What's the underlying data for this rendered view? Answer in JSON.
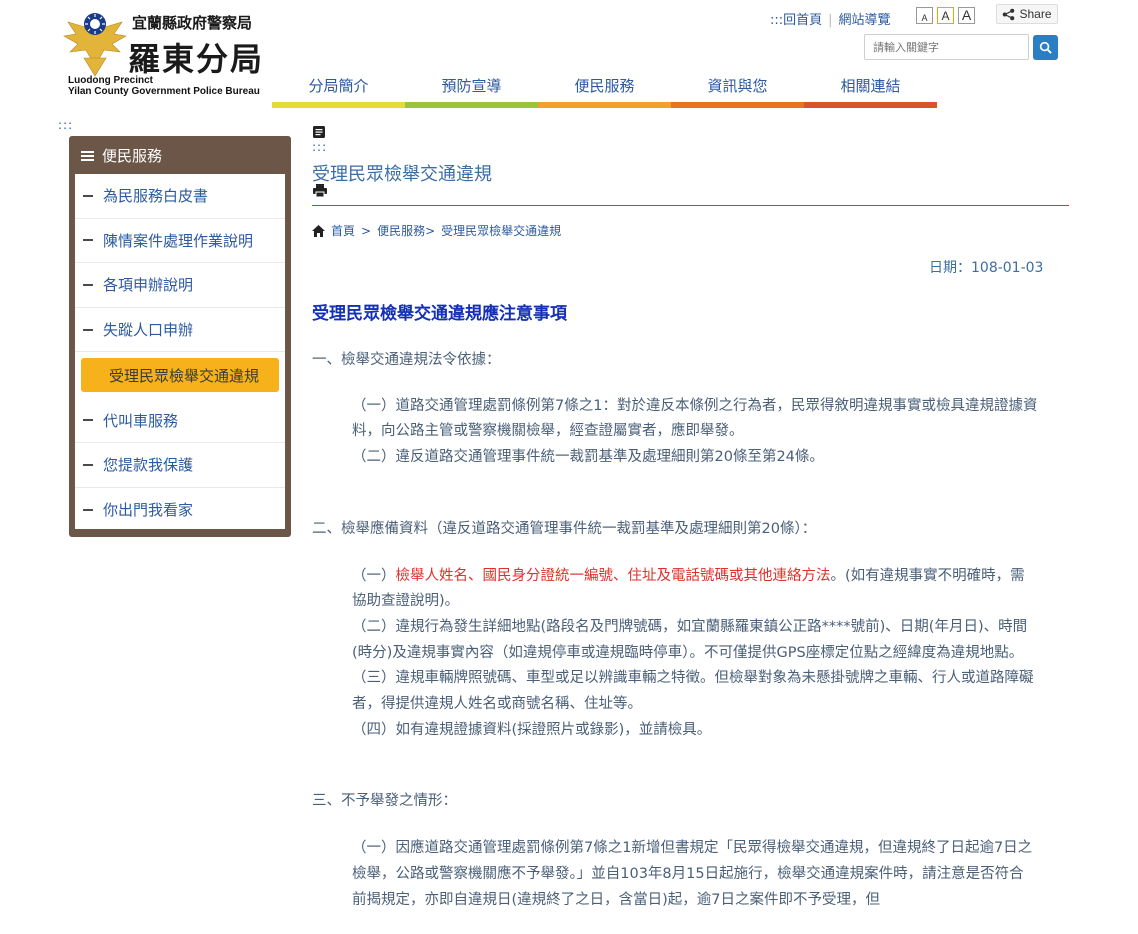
{
  "header": {
    "agency_line": "宜蘭縣政府警察局",
    "bureau_name": "羅東分局",
    "english_line1": "Luodong Precinct",
    "english_line2": "Yilan County Government Police Bureau"
  },
  "toplinks": {
    "home": ":::回首頁",
    "sitemap": "網站導覽"
  },
  "font_size_buttons": [
    "A",
    "A",
    "A"
  ],
  "share": {
    "label": "Share"
  },
  "search": {
    "placeholder": "請輸入關鍵字"
  },
  "main_nav": [
    {
      "label": "分局簡介",
      "color": "#e6d93a"
    },
    {
      "label": "預防宣導",
      "color": "#9bc43a"
    },
    {
      "label": "便民服務",
      "color": "#f2a02c"
    },
    {
      "label": "資訊與您",
      "color": "#e8731f"
    },
    {
      "label": "相關連結",
      "color": "#d9532b"
    }
  ],
  "accesskey_left": ":::",
  "accesskey_main": ":::",
  "sidebar": {
    "title": "便民服務",
    "items": [
      {
        "label": "為民服務白皮書",
        "active": false
      },
      {
        "label": "陳情案件處理作業說明",
        "active": false
      },
      {
        "label": "各項申辦說明",
        "active": false
      },
      {
        "label": "失蹤人口申辦",
        "active": false
      },
      {
        "label": "受理民眾檢舉交通違規",
        "active": true
      },
      {
        "label": "代叫車服務",
        "active": false
      },
      {
        "label": "您提款我保護",
        "active": false
      },
      {
        "label": "你出門我看家",
        "active": false
      }
    ]
  },
  "page": {
    "title": "受理民眾檢舉交通違規",
    "breadcrumb": [
      "首頁",
      ">",
      "便民服務>",
      "受理民眾檢舉交通違規"
    ],
    "date": "日期：108-01-03"
  },
  "article": {
    "heading": "受理民眾檢舉交通違規應注意事項",
    "s1_title": "一、檢舉交通違規法令依據：",
    "s1_p1": "（一）道路交通管理處罰條例第7條之1：對於違反本條例之行為者，民眾得敘明違規事實或檢具違規證據資料，向公路主管或警察機關檢舉，經查證屬實者，應即舉發。",
    "s1_p2": "（二）違反道路交通管理事件統一裁罰基準及處理細則第20條至第24條。",
    "s2_title": "二、檢舉應備資料（違反道路交通管理事件統一裁罰基準及處理細則第20條）：",
    "s2_p1_prefix": "（一）",
    "s2_p1_red": "檢舉人姓名、國民身分證統一編號、住址及電話號碼或其他連絡方法",
    "s2_p1_suffix": "。(如有違規事實不明確時，需協助查證說明)。",
    "s2_p2": "（二）違規行為發生詳細地點(路段名及門牌號碼，如宜蘭縣羅東鎮公正路****號前)、日期(年月日)、時間(時分)及違規事實內容（如違規停車或違規臨時停車）。不可僅提供GPS座標定位點之經緯度為違規地點。",
    "s2_p3": "（三）違規車輛牌照號碼、車型或足以辨識車輛之特徵。但檢舉對象為未懸掛號牌之車輛、行人或道路障礙者，得提供違規人姓名或商號名稱、住址等。",
    "s2_p4": "（四）如有違規證據資料(採證照片或錄影)，並請檢具。",
    "s3_title": "三、不予舉發之情形：",
    "s3_p1": "（一）因應道路交通管理處罰條例第7條之1新增但書規定「民眾得檢舉交通違規，但違規終了日起逾7日之檢舉，公路或警察機關應不予舉發。」並自103年8月15日起施行，檢舉交通違規案件時，請注意是否符合前揭規定，亦即自違規日(違規終了之日，含當日)起，逾7日之案件即不予受理，但"
  }
}
